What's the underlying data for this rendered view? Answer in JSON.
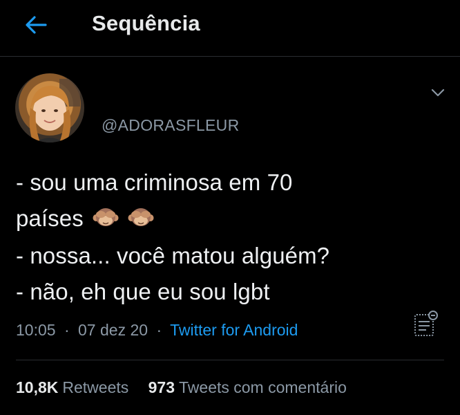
{
  "header": {
    "title": "Sequência",
    "back_icon": "arrow-left-icon",
    "accent_color": "#1d9bf0"
  },
  "author": {
    "handle": "@ADORASFLEUR",
    "avatar_icon": "profile-photo"
  },
  "tweet": {
    "lines": [
      "- sou uma criminosa em 70",
      "países",
      "- nossa... você matou alguém?",
      "- não, eh que eu sou lgbt"
    ],
    "emoji": [
      "see-no-evil-monkey-emoji",
      "see-no-evil-monkey-emoji"
    ]
  },
  "meta": {
    "time": "10:05",
    "date": "07 dez 20",
    "separator": "·",
    "source": "Twitter for Android"
  },
  "stats": {
    "retweets_count": "10,8K",
    "retweets_label": "Retweets",
    "quotes_count": "973",
    "quotes_label": "Tweets com comentário"
  }
}
